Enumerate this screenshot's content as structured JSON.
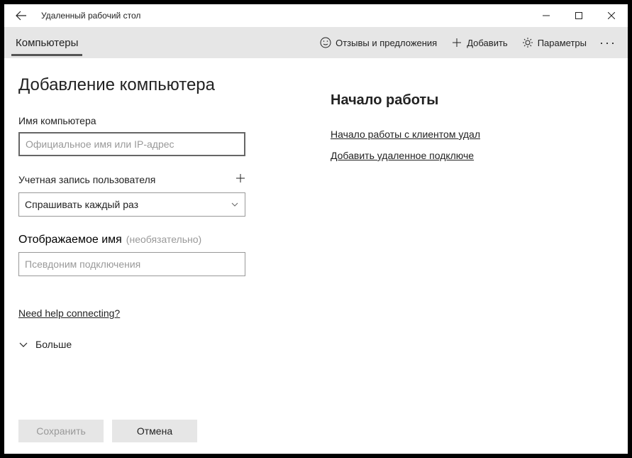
{
  "titlebar": {
    "app_title": "Удаленный рабочий стол"
  },
  "toolbar": {
    "tab_label": "Компьютеры",
    "feedback": "Отзывы и предложения",
    "add": "Добавить",
    "settings": "Параметры"
  },
  "main": {
    "page_title": "Добавление компьютера",
    "pc_name_label": "Имя компьютера",
    "pc_name_placeholder": "Официальное имя или IP-адрес",
    "user_account_label": "Учетная запись пользователя",
    "user_account_selected": "Спрашивать каждый раз",
    "display_name_label": "Отображаемое имя",
    "display_name_optional": "(необязательно)",
    "display_name_placeholder": "Псевдоним подключения",
    "help_link": "Need help connecting?",
    "more_label": "Больше",
    "save_label": "Сохранить",
    "cancel_label": "Отмена"
  },
  "side": {
    "title": "Начало работы",
    "link1": "Начало работы с клиентом удал",
    "link2": "Добавить удаленное подключе"
  }
}
